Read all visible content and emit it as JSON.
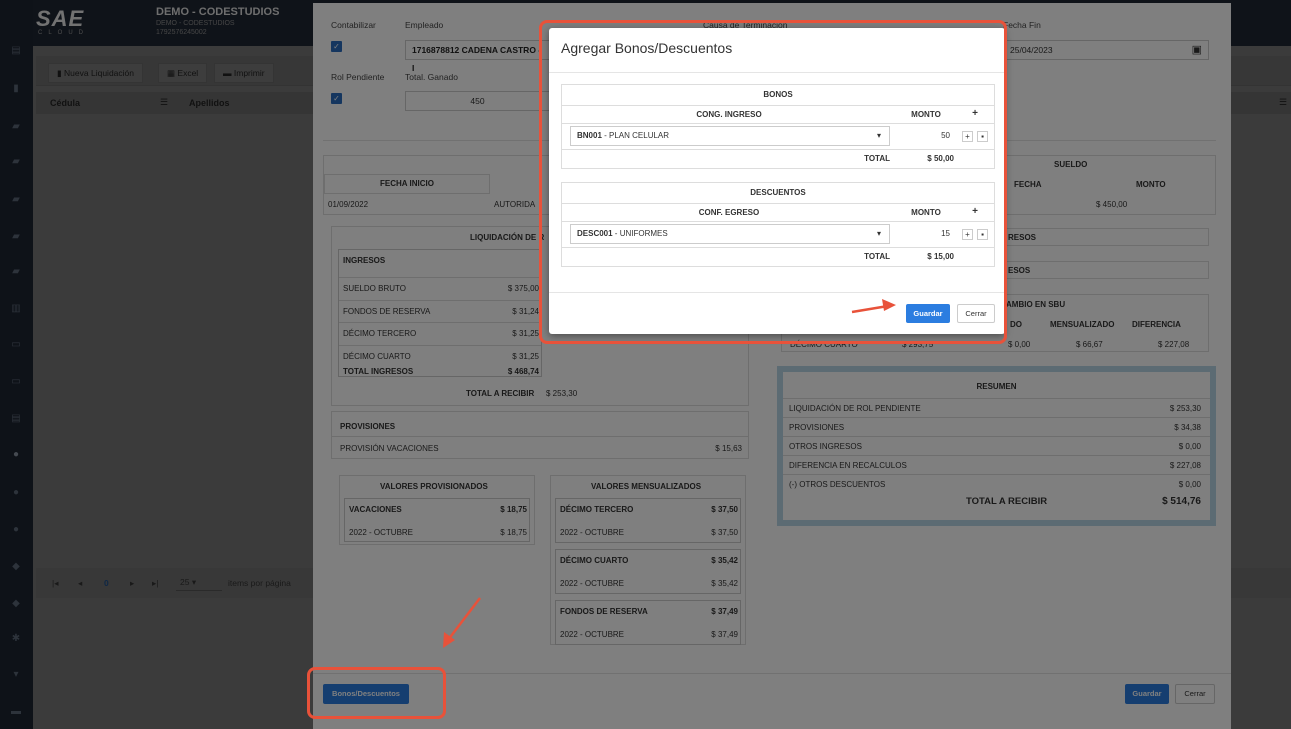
{
  "app": {
    "logo": "SAE",
    "logo_sub": "CLOUD",
    "company": "DEMO - CODESTUDIOS",
    "company_sub": "DEMO - CODESTUDIOS",
    "ruc": "1792576245002"
  },
  "toolbar": {
    "nueva_liquidacion": "Nueva Liquidación",
    "excel": "Excel",
    "imprimir": "Imprimir"
  },
  "bg_table": {
    "col_cedula": "Cédula",
    "col_apellidos": "Apellidos"
  },
  "pager": {
    "current": "0",
    "page_size": "25",
    "items_label": "items por página"
  },
  "form": {
    "contabilizar_label": "Contabilizar",
    "empleado_label": "Empleado",
    "empleado_value": "1716878812 CADENA CASTRO - I",
    "causa_label": "Causa de Terminación",
    "fecha_fin_label": "Fecha Fin",
    "fecha_fin_value": "25/04/2023",
    "rol_pendiente_label": "Rol Pendiente",
    "total_ganado_label": "Total. Ganado",
    "total_ganado_value": "450"
  },
  "info_table": {
    "fecha_inicio_label": "FECHA INICIO",
    "fecha_inicio_value": "01/09/2022",
    "autoridad_value": "AUTORIDA",
    "sueldo_label": "SUELDO",
    "fecha_label": "FECHA",
    "monto_label": "MONTO",
    "monto_value": "$ 450,00"
  },
  "liquidacion": {
    "title": "LIQUIDACIÓN DE R",
    "ingresos_label": "INGRESOS",
    "rows": [
      {
        "label": "SUELDO BRUTO",
        "value": "$ 375,00"
      },
      {
        "label": "FONDOS DE RESERVA",
        "value": "$ 31,24"
      },
      {
        "label": "DÉCIMO TERCERO",
        "value": "$ 31,25"
      },
      {
        "label": "DÉCIMO CUARTO",
        "value": "$ 31,25"
      }
    ],
    "total_label": "TOTAL INGRESOS",
    "total_value": "$ 468,74",
    "total_recibir_label": "TOTAL A RECIBIR",
    "total_recibir_value": "$ 253,30"
  },
  "right_sections": {
    "otros_ingresos": "RESOS",
    "otros_descuentos": "ESOS",
    "cambio_sbu": "AMBIO EN SBU",
    "col_do": "DO",
    "col_mensualizado": "MENSUALIZADO",
    "col_diferencia": "DIFERENCIA",
    "row_label": "DÉCIMO CUARTO",
    "row_value": "$ 293,75",
    "row_do": "$ 0,00",
    "row_mens": "$ 66,67",
    "row_dif": "$ 227,08"
  },
  "provisiones": {
    "title": "PROVISIONES",
    "row_label": "PROVISIÓN VACACIONES",
    "row_value": "$ 15,63"
  },
  "valores_provisionados": {
    "title": "VALORES PROVISIONADOS",
    "group": "VACACIONES",
    "group_value": "$ 18,75",
    "row": "2022 - OCTUBRE",
    "row_value": "$ 18,75"
  },
  "valores_mensualizados": {
    "title": "VALORES MENSUALIZADOS",
    "groups": [
      {
        "label": "DÉCIMO TERCERO",
        "value": "$ 37,50",
        "row": "2022 - OCTUBRE",
        "row_value": "$ 37,50"
      },
      {
        "label": "DÉCIMO CUARTO",
        "value": "$ 35,42",
        "row": "2022 - OCTUBRE",
        "row_value": "$ 35,42"
      },
      {
        "label": "FONDOS DE RESERVA",
        "value": "$ 37,49",
        "row": "2022 - OCTUBRE",
        "row_value": "$ 37,49"
      }
    ]
  },
  "resumen": {
    "title": "RESUMEN",
    "rows": [
      {
        "label": "LIQUIDACIÓN DE ROL PENDIENTE",
        "value": "$ 253,30"
      },
      {
        "label": "PROVISIONES",
        "value": "$ 34,38"
      },
      {
        "label": "OTROS INGRESOS",
        "value": "$ 0,00"
      },
      {
        "label": "DIFERENCIA EN RECALCULOS",
        "value": "$ 227,08"
      },
      {
        "label": "(-) OTROS DESCUENTOS",
        "value": "$ 0,00"
      }
    ],
    "total_label": "TOTAL A RECIBIR",
    "total_value": "$ 514,76"
  },
  "footer": {
    "bonos_btn": "Bonos/Descuentos",
    "guardar": "Guardar",
    "cerrar": "Cerrar"
  },
  "dialog": {
    "title": "Agregar Bonos/Descuentos",
    "bonos": {
      "header": "BONOS",
      "col_concept": "CONG. INGRESO",
      "col_monto": "MONTO",
      "item_code": "BN001",
      "item_name": " - PLAN CELULAR",
      "item_monto": "50",
      "total_label": "TOTAL",
      "total_value": "$ 50,00"
    },
    "descuentos": {
      "header": "DESCUENTOS",
      "col_concept": "CONF. EGRESO",
      "col_monto": "MONTO",
      "item_code": "DESC001",
      "item_name": " - UNIFORMES",
      "item_monto": "15",
      "total_label": "TOTAL",
      "total_value": "$ 15,00"
    },
    "guardar": "Guardar",
    "cerrar": "Cerrar"
  },
  "colors": {
    "accent": "#2b7de0",
    "highlight": "#e8523a",
    "resumen_border": "#b9d7e6"
  }
}
